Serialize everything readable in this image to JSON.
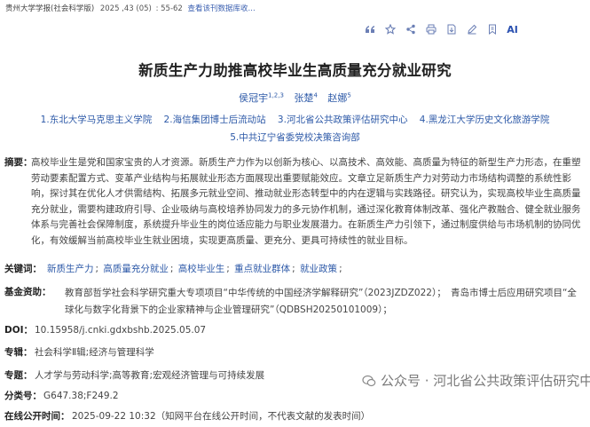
{
  "source": {
    "publication": "贵州大学学报(社会科学版)",
    "issue": "2025 ,43 (05)",
    "pages": "55-62",
    "database_link": "查看该刊数据库收..."
  },
  "toolbar": {
    "icons": [
      "quote-icon",
      "star-icon",
      "share-icon",
      "print-icon",
      "download-icon",
      "note-icon",
      "bookmark-icon"
    ],
    "ai_label": "AI"
  },
  "title": "新质生产力助推高校毕业生高质量充分就业研究",
  "authors": [
    {
      "name": "侯冠宇",
      "sup": "1,2,3"
    },
    {
      "name": "张楚",
      "sup": "4"
    },
    {
      "name": "赵娜",
      "sup": "5"
    }
  ],
  "affiliations": [
    "1.东北大学马克思主义学院",
    "2.海信集团博士后流动站",
    "3.河北省公共政策评估研究中心",
    "4.黑龙江大学历史文化旅游学院",
    "5.中共辽宁省委党校决策咨询部"
  ],
  "abstract": {
    "label": "摘要：",
    "text": "高校毕业生是党和国家宝贵的人才资源。新质生产力作为以创新为核心、以高技术、高效能、高质量为特征的新型生产力形态，在重塑劳动要素配置方式、变革产业结构与拓展就业形态方面展现出重要赋能效应。文章立足新质生产力对劳动力市场结构调整的系统性影响，探讨其在优化人才供需结构、拓展多元就业空间、推动就业形态转型中的内在逻辑与实践路径。研究认为，实现高校毕业生高质量充分就业，需要构建政府引导、企业吸纳与高校培养协同发力的多元协作机制，通过深化教育体制改革、强化产教融合、健全就业服务体系与完善社会保障制度，系统提升毕业生的岗位适应能力与职业发展潜力。在新质生产力引领下，通过制度供给与市场机制的协同优化，有效缓解当前高校毕业生就业困境，实现更高质量、更充分、更具可持续性的就业目标。"
  },
  "keywords": {
    "label": "关键词：",
    "items": [
      "新质生产力",
      "高质量充分就业",
      "高校毕业生",
      "重点就业群体",
      "就业政策"
    ]
  },
  "funding": {
    "label": "基金资助：",
    "text": "教育部哲学社会科学研究重大专项项目“中华传统的中国经济学解释研究”（2023JZDZ022）；　青岛市博士后应用研究项目“全球化与数字化背景下的企业家精神与企业管理研究”（QDBSH20250101009）；"
  },
  "doi": {
    "label": "DOI：",
    "value": "10.15958/j.cnki.gdxbshb.2025.05.07"
  },
  "series": {
    "label": "专辑：",
    "value": "社会科学Ⅱ辑;经济与管理科学"
  },
  "topic": {
    "label": "专题：",
    "value": "人才学与劳动科学;高等教育;宏观经济管理与可持续发展"
  },
  "classification": {
    "label": "分类号：",
    "value": "G647.38;F249.2"
  },
  "online_time": {
    "label": "在线公开时间：",
    "value": "2025-09-22 10:32（知网平台在线公开时间，不代表文献的发表时间）"
  },
  "watermark": {
    "text": "公众号 · 河北省公共政策评估研究中心"
  },
  "colors": {
    "link": "#2e5aa8",
    "text": "#444444",
    "label": "#222222"
  }
}
